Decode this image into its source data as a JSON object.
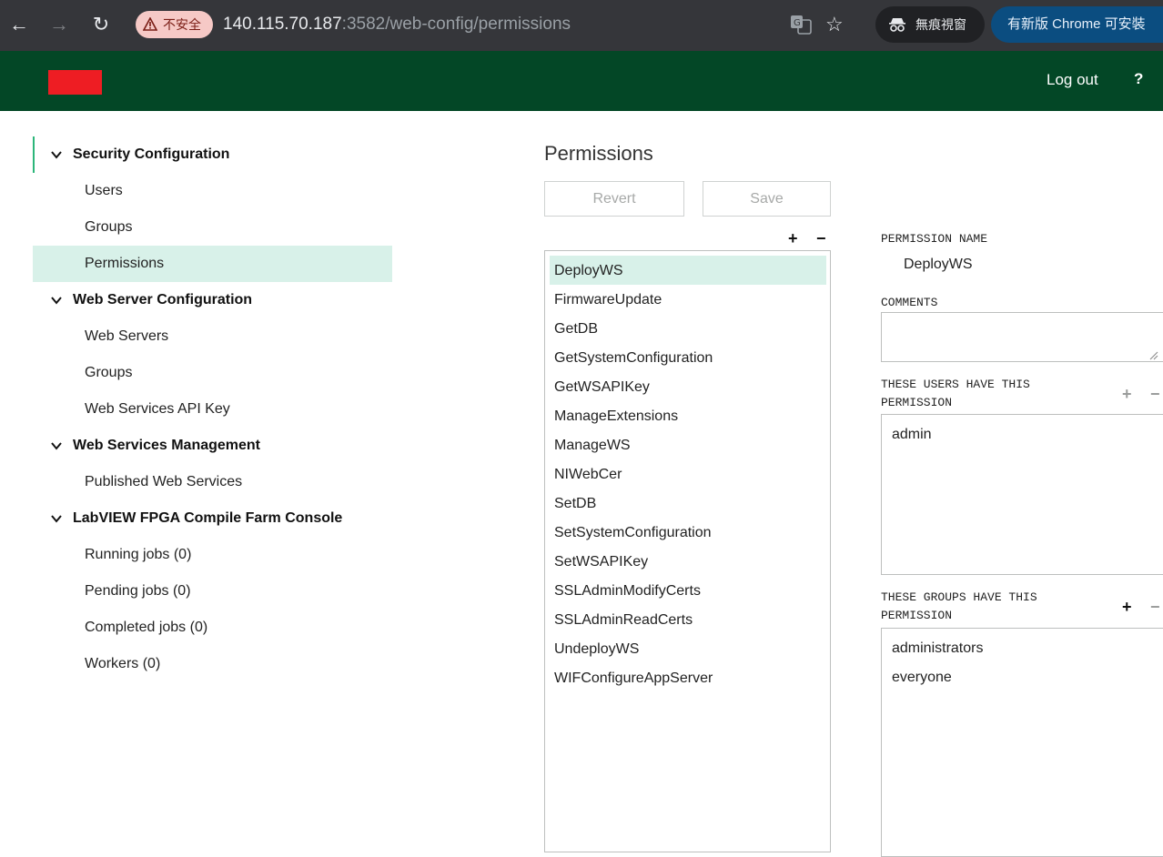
{
  "browser": {
    "security_label": "不安全",
    "url_host": "140.115.70.187",
    "url_rest": ":3582/web-config/permissions",
    "incognito_label": "無痕視窗",
    "update_label": "有新版 Chrome 可安裝"
  },
  "header": {
    "logout_label": "Log out",
    "help_label": "?",
    "logo_color": "#ee1d23",
    "bar_color": "#034726"
  },
  "sidebar": {
    "sections": [
      {
        "label": "Security Configuration",
        "items": [
          "Users",
          "Groups",
          "Permissions"
        ]
      },
      {
        "label": "Web Server Configuration",
        "items": [
          "Web Servers",
          "Groups",
          "Web Services API Key"
        ]
      },
      {
        "label": "Web Services Management",
        "items": [
          "Published Web Services"
        ]
      },
      {
        "label": "LabVIEW FPGA Compile Farm Console",
        "items": [
          "Running jobs (0)",
          "Pending jobs (0)",
          "Completed jobs (0)",
          "Workers (0)"
        ]
      }
    ],
    "selected_item": "Permissions"
  },
  "main": {
    "title": "Permissions",
    "revert_label": "Revert",
    "save_label": "Save",
    "add_symbol": "+",
    "remove_symbol": "−",
    "permissions": [
      "DeployWS",
      "FirmwareUpdate",
      "GetDB",
      "GetSystemConfiguration",
      "GetWSAPIKey",
      "ManageExtensions",
      "ManageWS",
      "NIWebCer",
      "SetDB",
      "SetSystemConfiguration",
      "SetWSAPIKey",
      "SSLAdminModifyCerts",
      "SSLAdminReadCerts",
      "UndeployWS",
      "WIFConfigureAppServer"
    ],
    "selected_permission": "DeployWS"
  },
  "detail": {
    "name_label": "PERMISSION NAME",
    "name_value": "DeployWS",
    "comments_label": "COMMENTS",
    "comments_value": "",
    "users_label_line1": "THESE USERS HAVE THIS",
    "users_label_line2": "PERMISSION",
    "users": [
      "admin"
    ],
    "groups_label_line1": "THESE GROUPS HAVE THIS",
    "groups_label_line2": "PERMISSION",
    "groups": [
      "administrators",
      "everyone"
    ]
  }
}
